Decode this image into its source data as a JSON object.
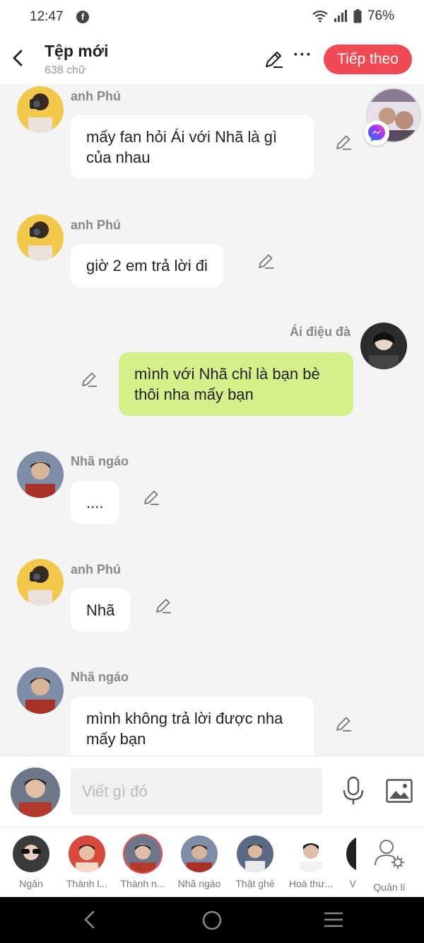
{
  "status_bar": {
    "time": "12:47",
    "battery": "76%"
  },
  "header": {
    "title": "Tệp mới",
    "subtitle": "638 chữ",
    "next_label": "Tiếp theo"
  },
  "messages": [
    {
      "sender": "anh Phú",
      "text": "mấy fan hỏi Ái với Nhã là gì của nhau",
      "side": "left"
    },
    {
      "sender": "anh Phú",
      "text": "giờ 2 em trả lời đi",
      "side": "left"
    },
    {
      "sender": "Ái điệu đà",
      "text": "mình với Nhã chỉ là bạn bè thôi nha mấy bạn",
      "side": "right"
    },
    {
      "sender": "Nhã ngáo",
      "text": "....",
      "side": "left"
    },
    {
      "sender": "anh Phú",
      "text": "Nhã",
      "side": "left"
    },
    {
      "sender": "Nhã ngáo",
      "text": "mình không trả lời được nha mấy bạn",
      "side": "left"
    }
  ],
  "composer": {
    "placeholder": "Viết gì đó"
  },
  "characters": [
    {
      "name": "Ngân"
    },
    {
      "name": "Thành l..."
    },
    {
      "name": "Thành n..."
    },
    {
      "name": "Nhã ngáo"
    },
    {
      "name": "Thật ghẻ"
    },
    {
      "name": "Hoà thư..."
    },
    {
      "name": "V"
    }
  ],
  "manage_label": "Quản lí",
  "colors": {
    "accent": "#f04a55",
    "my_bubble": "#d3f08a"
  }
}
